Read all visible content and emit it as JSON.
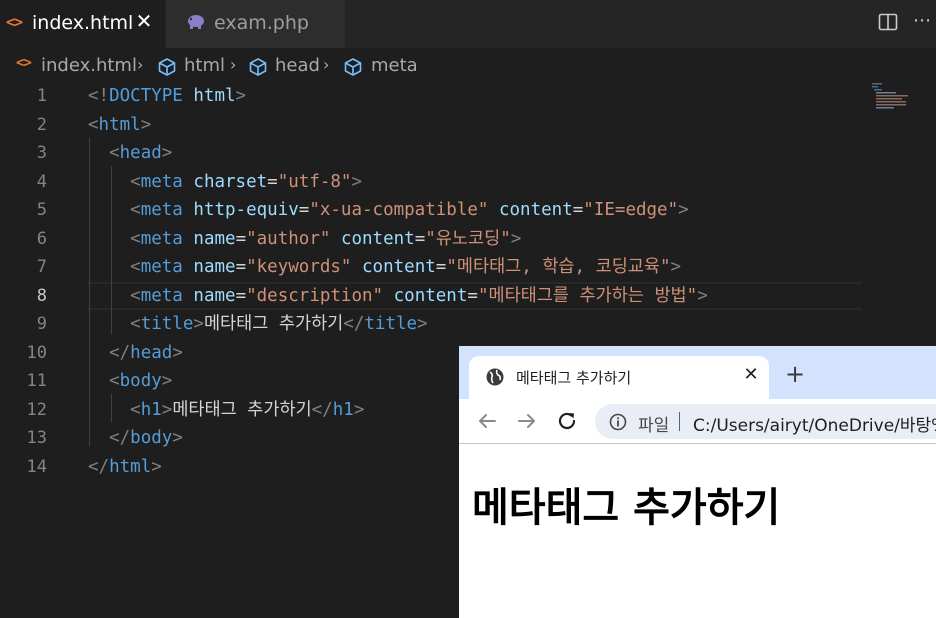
{
  "editor_tabs": [
    {
      "icon": "html-file-icon",
      "label": "index.html",
      "active": true
    },
    {
      "icon": "php-elephant-icon",
      "label": "exam.php",
      "active": false
    }
  ],
  "breadcrumb": {
    "file": "index.html",
    "items": [
      "html",
      "head",
      "meta"
    ]
  },
  "current_line": 8,
  "lines": [
    {
      "no": "1",
      "tokens": [
        [
          "br",
          "<!"
        ],
        [
          "tag",
          "DOCTYPE"
        ],
        [
          "txt",
          " "
        ],
        [
          "attr",
          "html"
        ],
        [
          "br",
          ">"
        ]
      ]
    },
    {
      "no": "2",
      "tokens": [
        [
          "br",
          "<"
        ],
        [
          "tag",
          "html"
        ],
        [
          "br",
          ">"
        ]
      ]
    },
    {
      "no": "3",
      "tokens": [
        [
          "txt",
          "  "
        ],
        [
          "br",
          "<"
        ],
        [
          "tag",
          "head"
        ],
        [
          "br",
          ">"
        ]
      ]
    },
    {
      "no": "4",
      "tokens": [
        [
          "txt",
          "    "
        ],
        [
          "br",
          "<"
        ],
        [
          "tag",
          "meta"
        ],
        [
          "txt",
          " "
        ],
        [
          "attr",
          "charset"
        ],
        [
          "eq",
          "="
        ],
        [
          "str",
          "\"utf-8\""
        ],
        [
          "br",
          ">"
        ]
      ]
    },
    {
      "no": "5",
      "tokens": [
        [
          "txt",
          "    "
        ],
        [
          "br",
          "<"
        ],
        [
          "tag",
          "meta"
        ],
        [
          "txt",
          " "
        ],
        [
          "attr",
          "http-equiv"
        ],
        [
          "eq",
          "="
        ],
        [
          "str",
          "\"x-ua-compatible\""
        ],
        [
          "txt",
          " "
        ],
        [
          "attr",
          "content"
        ],
        [
          "eq",
          "="
        ],
        [
          "str",
          "\"IE=edge\""
        ],
        [
          "br",
          ">"
        ]
      ]
    },
    {
      "no": "6",
      "tokens": [
        [
          "txt",
          "    "
        ],
        [
          "br",
          "<"
        ],
        [
          "tag",
          "meta"
        ],
        [
          "txt",
          " "
        ],
        [
          "attr",
          "name"
        ],
        [
          "eq",
          "="
        ],
        [
          "str",
          "\"author\""
        ],
        [
          "txt",
          " "
        ],
        [
          "attr",
          "content"
        ],
        [
          "eq",
          "="
        ],
        [
          "str",
          "\"유노코딩\""
        ],
        [
          "br",
          ">"
        ]
      ]
    },
    {
      "no": "7",
      "tokens": [
        [
          "txt",
          "    "
        ],
        [
          "br",
          "<"
        ],
        [
          "tag",
          "meta"
        ],
        [
          "txt",
          " "
        ],
        [
          "attr",
          "name"
        ],
        [
          "eq",
          "="
        ],
        [
          "str",
          "\"keywords\""
        ],
        [
          "txt",
          " "
        ],
        [
          "attr",
          "content"
        ],
        [
          "eq",
          "="
        ],
        [
          "str",
          "\"메타태그, 학습, 코딩교육\""
        ],
        [
          "br",
          ">"
        ]
      ]
    },
    {
      "no": "8",
      "tokens": [
        [
          "txt",
          "    "
        ],
        [
          "br",
          "<"
        ],
        [
          "tag",
          "meta"
        ],
        [
          "txt",
          " "
        ],
        [
          "attr",
          "name"
        ],
        [
          "eq",
          "="
        ],
        [
          "str",
          "\"description\""
        ],
        [
          "txt",
          " "
        ],
        [
          "attr",
          "content"
        ],
        [
          "eq",
          "="
        ],
        [
          "str",
          "\"메타태그를 추가하는 방법\""
        ],
        [
          "br",
          ">"
        ]
      ]
    },
    {
      "no": "9",
      "tokens": [
        [
          "txt",
          "    "
        ],
        [
          "br",
          "<"
        ],
        [
          "tag",
          "title"
        ],
        [
          "br",
          ">"
        ],
        [
          "txt",
          "메타태그 추가하기"
        ],
        [
          "br",
          "</"
        ],
        [
          "tag",
          "title"
        ],
        [
          "br",
          ">"
        ]
      ]
    },
    {
      "no": "10",
      "tokens": [
        [
          "txt",
          "  "
        ],
        [
          "br",
          "</"
        ],
        [
          "tag",
          "head"
        ],
        [
          "br",
          ">"
        ]
      ]
    },
    {
      "no": "11",
      "tokens": [
        [
          "txt",
          "  "
        ],
        [
          "br",
          "<"
        ],
        [
          "tag",
          "body"
        ],
        [
          "br",
          ">"
        ]
      ]
    },
    {
      "no": "12",
      "tokens": [
        [
          "txt",
          "    "
        ],
        [
          "br",
          "<"
        ],
        [
          "tag",
          "h1"
        ],
        [
          "br",
          ">"
        ],
        [
          "txt",
          "메타태그 추가하기"
        ],
        [
          "br",
          "</"
        ],
        [
          "tag",
          "h1"
        ],
        [
          "br",
          ">"
        ]
      ]
    },
    {
      "no": "13",
      "tokens": [
        [
          "txt",
          "  "
        ],
        [
          "br",
          "</"
        ],
        [
          "tag",
          "body"
        ],
        [
          "br",
          ">"
        ]
      ]
    },
    {
      "no": "14",
      "tokens": [
        [
          "br",
          "</"
        ],
        [
          "tag",
          "html"
        ],
        [
          "br",
          ">"
        ]
      ]
    }
  ],
  "browser": {
    "tab_title": "메타태그 추가하기",
    "new_tab": "+",
    "omnibox_label": "파일",
    "omnibox_url": "C:/Users/airyt/OneDrive/바탕%",
    "page_heading": "메타태그 추가하기"
  },
  "colors": {
    "editor_bg": "#1e1e1e",
    "tag": "#569cd6",
    "attribute": "#9cdcfe",
    "string": "#ce9178",
    "bracket": "#808080",
    "html_icon": "#e37933",
    "browser_tabstrip": "#d3e3fd"
  }
}
